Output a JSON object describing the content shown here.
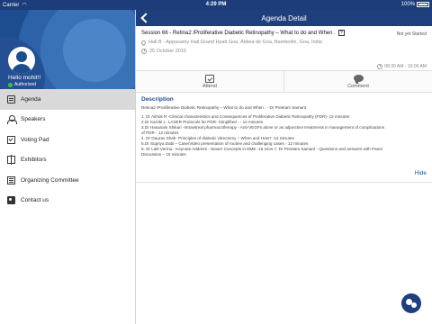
{
  "status_bar": {
    "carrier": "Carrier",
    "time": "4:29 PM",
    "battery": "100%"
  },
  "sidebar": {
    "greeting": "Hello mohit!!",
    "status": "Authorized",
    "items": [
      {
        "label": "Agenda",
        "icon": "agenda-icon"
      },
      {
        "label": "Speakers",
        "icon": "speakers-icon"
      },
      {
        "label": "Voting Pad",
        "icon": "voting-pad-icon"
      },
      {
        "label": "Exhibitors",
        "icon": "exhibitors-icon"
      },
      {
        "label": "Organizing Committee",
        "icon": "organizing-committee-icon"
      },
      {
        "label": "Contact us",
        "icon": "contact-icon"
      }
    ],
    "active": "Agenda"
  },
  "header": {
    "title": "Agenda Detail"
  },
  "session": {
    "title": "Session 66 - Retina2 /Proliferative Diabetic Retinopathy – What to do and When .",
    "badge": "?",
    "status": "Not yet Started",
    "location": "Hall B - Appasamy Hall,Grand Hyatt Goa, Aldeia de Goa, Bambolim, Goa, India",
    "date": "25 October 2015",
    "time_range": "08:30 AM - 10:00 AM"
  },
  "actions": {
    "attend": "Attend",
    "comment": "Comment"
  },
  "description": {
    "heading": "Description",
    "subtitle": "Retina2 /Proliferative Diabetic Retinopathy – What to do and When . - Dr Preetam Samant",
    "lines": [
      "1. Dr Ashok R -Clinical characteristics and Consequences of Proliferative Diabetic Retinopathy (PDR)- 12 minutes",
      "2.Dr Karobi L- LASER Protocols for PDR- Simplified - - 12 minutes",
      "3.Dr Hasanain Shikari -Intravitreal pharmacotherapy - Anti-VEGFs alone or as adjunctive treatments in management of complications",
      "of PDR - 12 minutes",
      "4. Dr Gaurav Shah- Principles of diabetic vitrectomy – When and How? -12 minutes",
      "5.Dr Supriya Dabi – Case/Video presentation of routine and challenging cases - 12 minutes",
      "6. Dr Lalit Verma - Keynote Address - Newer Concepts in DME -15 mins 7. Dr Preetam Samant - Questions and answers with Panel",
      "Discussion – 15 minutes"
    ],
    "hide_label": "Hide"
  },
  "colors": {
    "nav": "#1e3f7c",
    "profile": "#1e4d8f",
    "accent": "#1e4d8f",
    "status_green": "#3cc24a"
  }
}
